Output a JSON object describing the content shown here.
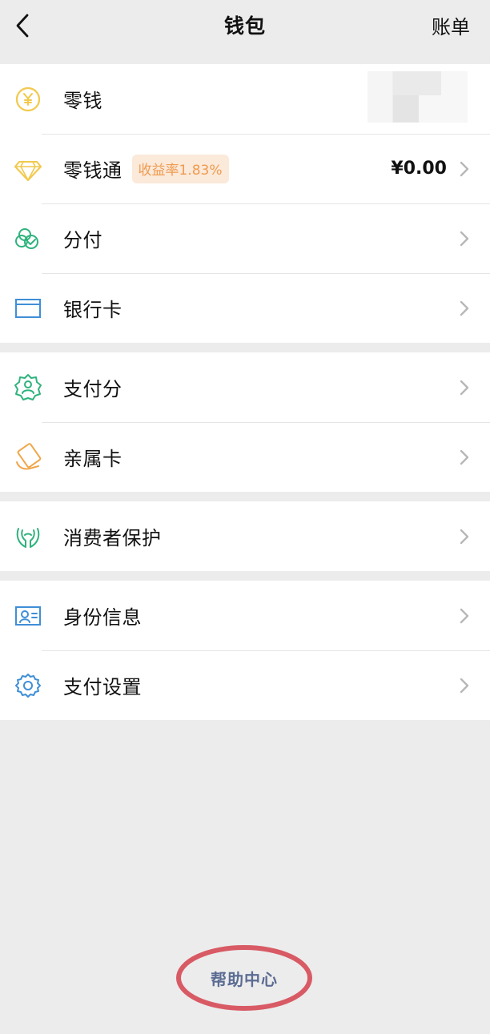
{
  "header": {
    "title": "钱包",
    "back_icon": "chevron-left-icon",
    "right_action": "账单"
  },
  "groups": [
    {
      "items": [
        {
          "label": "零钱",
          "icon": "yen-circle-icon",
          "color": "#f2c94c"
        },
        {
          "label": "零钱通",
          "icon": "diamond-icon",
          "color": "#f2c94c",
          "badge": "收益率1.83%",
          "value": "¥0.00"
        },
        {
          "label": "分付",
          "icon": "card-check-icon",
          "color": "#2fb37d"
        },
        {
          "label": "银行卡",
          "icon": "bank-card-icon",
          "color": "#3f8fd7"
        }
      ]
    },
    {
      "items": [
        {
          "label": "支付分",
          "icon": "badge-person-icon",
          "color": "#2fb37d"
        },
        {
          "label": "亲属卡",
          "icon": "family-card-icon",
          "color": "#f0a64a"
        }
      ]
    },
    {
      "items": [
        {
          "label": "消费者保护",
          "icon": "hands-protect-icon",
          "color": "#2fb37d"
        }
      ]
    },
    {
      "items": [
        {
          "label": "身份信息",
          "icon": "id-card-icon",
          "color": "#3f8fd7"
        },
        {
          "label": "支付设置",
          "icon": "gear-icon",
          "color": "#3f8fd7"
        }
      ]
    }
  ],
  "help": {
    "label": "帮助中心",
    "highlight_color": "#d85a64",
    "text_color": "#5b6c93"
  },
  "colors": {
    "background": "#ececec",
    "row": "#ffffff",
    "chevron": "#b7b7b7"
  }
}
